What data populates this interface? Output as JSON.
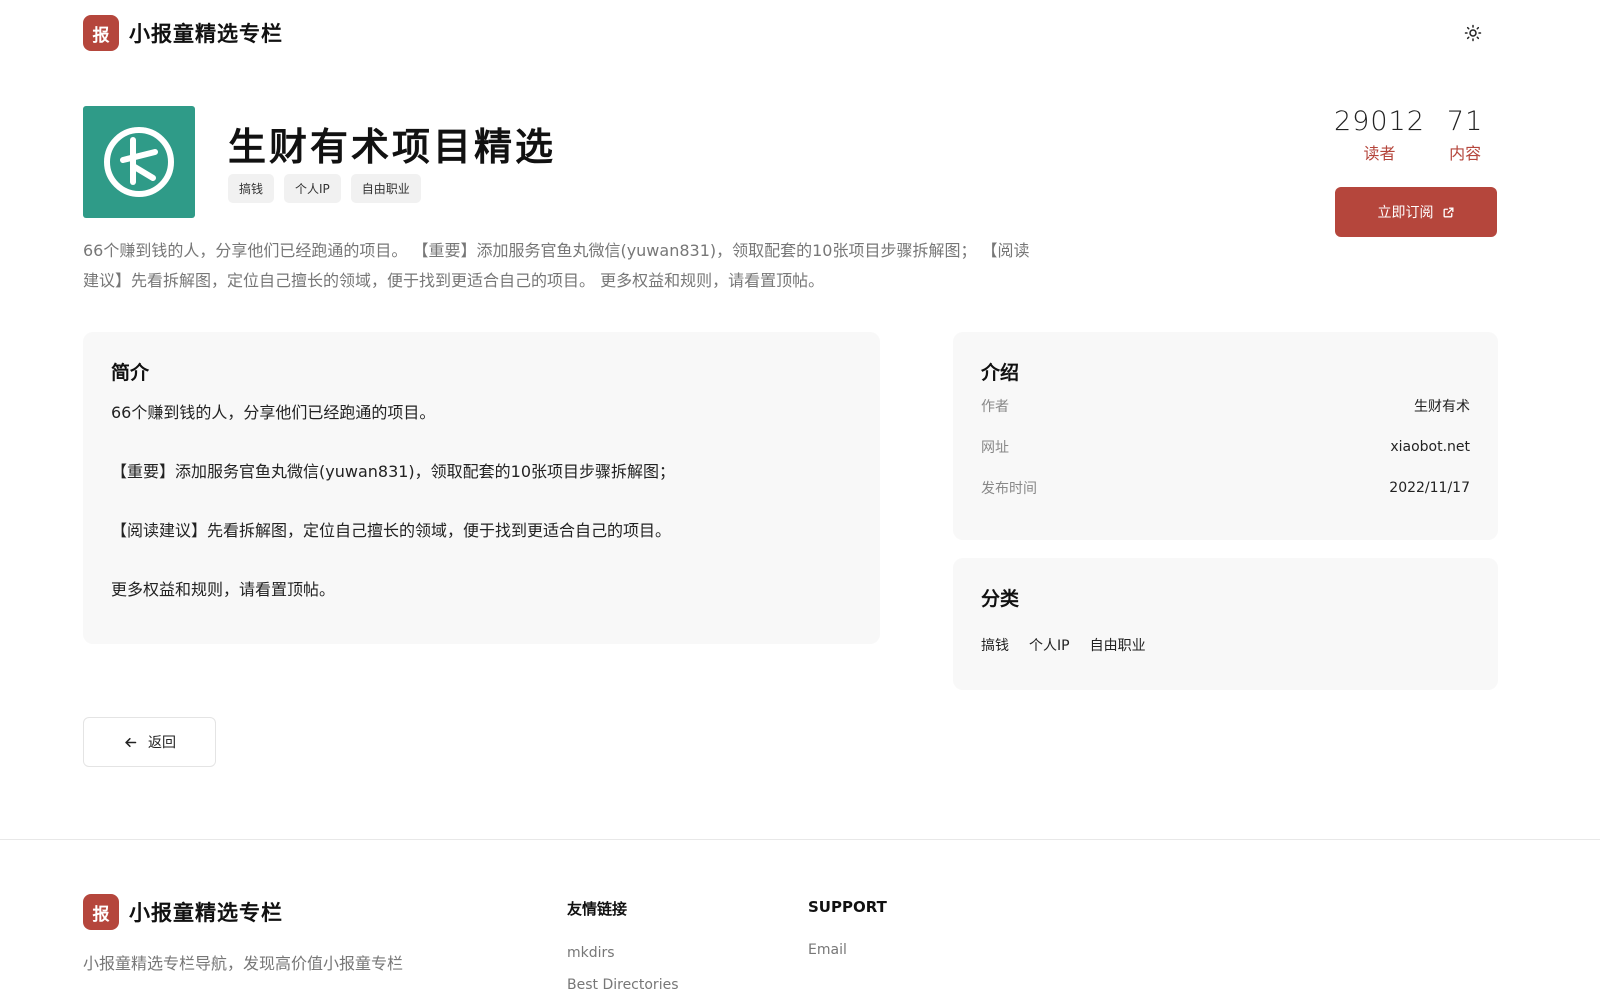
{
  "site": {
    "logo_char": "报",
    "name": "小报童精选专栏"
  },
  "column": {
    "title": "生财有术项目精选",
    "tags": [
      "搞钱",
      "个人IP",
      "自由职业"
    ],
    "readers": "29012",
    "readers_label": "读者",
    "contents": "71",
    "contents_label": "内容",
    "subscribe_label": "立即订阅",
    "description": "66个赚到钱的人，分享他们已经跑通的项目。 【重要】添加服务官鱼丸微信(yuwan831)，领取配套的10张项目步骤拆解图； 【阅读建议】先看拆解图，定位自己擅长的领域，便于找到更适合自己的项目。 更多权益和规则，请看置顶帖。",
    "icon_color": "#2f9b88"
  },
  "intro_card": {
    "title": "简介",
    "paragraphs": [
      "66个赚到钱的人，分享他们已经跑通的项目。",
      "【重要】添加服务官鱼丸微信(yuwan831)，领取配套的10张项目步骤拆解图；",
      "【阅读建议】先看拆解图，定位自己擅长的领域，便于找到更适合自己的项目。",
      "更多权益和规则，请看置顶帖。"
    ]
  },
  "info_card": {
    "title": "介绍",
    "rows": [
      {
        "key": "作者",
        "value": "生财有术"
      },
      {
        "key": "网址",
        "value": "xiaobot.net"
      },
      {
        "key": "发布时间",
        "value": "2022/11/17"
      }
    ]
  },
  "category_card": {
    "title": "分类",
    "items": [
      "搞钱",
      "个人IP",
      "自由职业"
    ]
  },
  "back_label": "返回",
  "footer": {
    "tagline": "小报童精选专栏导航，发现高价值小报童专栏",
    "friends_title": "友情链接",
    "friends_links": [
      "mkdirs",
      "Best Directories"
    ],
    "support_title": "SUPPORT",
    "support_links": [
      "Email"
    ]
  },
  "colors": {
    "brand": "#b5463c",
    "icon_bg": "#2f9b88"
  }
}
